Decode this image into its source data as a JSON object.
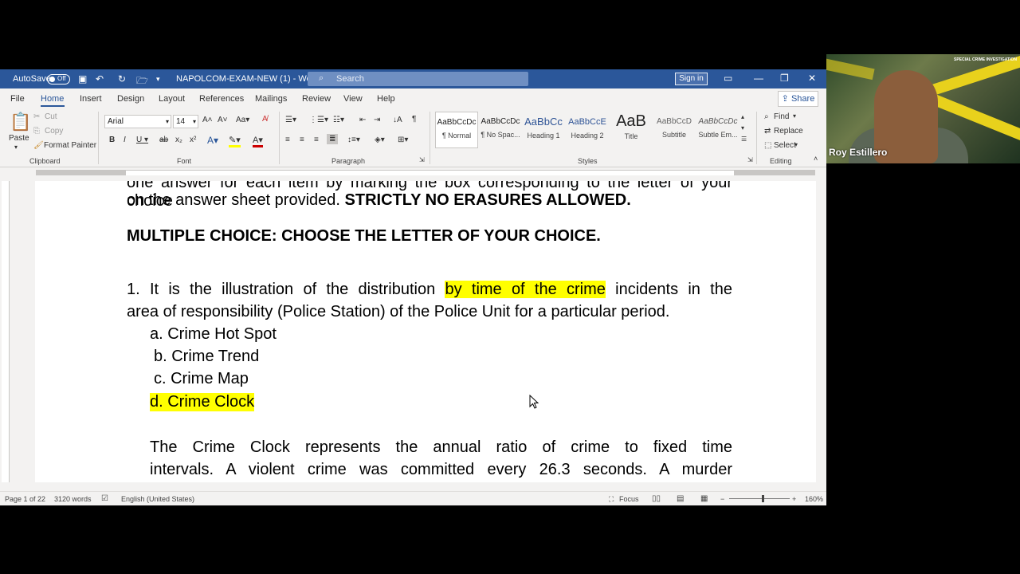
{
  "titlebar": {
    "autosave_label": "AutoSave",
    "autosave_state": "Off",
    "doc_title": "NAPOLCOM-EXAM-NEW (1)  -  Word",
    "search_placeholder": "Search",
    "signin_label": "Sign in"
  },
  "menu": {
    "tabs": [
      "File",
      "Home",
      "Insert",
      "Design",
      "Layout",
      "References",
      "Mailings",
      "Review",
      "View",
      "Help"
    ],
    "active": "Home",
    "share_label": "Share"
  },
  "ribbon": {
    "clipboard": {
      "paste": "Paste",
      "cut": "Cut",
      "copy": "Copy",
      "format_painter": "Format Painter",
      "group": "Clipboard"
    },
    "font": {
      "name": "Arial",
      "size": "14",
      "group": "Font"
    },
    "paragraph": {
      "group": "Paragraph"
    },
    "styles": {
      "group": "Styles",
      "items": [
        {
          "sample": "AaBbCcDc",
          "name": "¶ Normal"
        },
        {
          "sample": "AaBbCcDc",
          "name": "¶ No Spac..."
        },
        {
          "sample": "AaBbCc",
          "name": "Heading 1"
        },
        {
          "sample": "AaBbCcE",
          "name": "Heading 2"
        },
        {
          "sample": "AaB",
          "name": "Title"
        },
        {
          "sample": "AaBbCcD",
          "name": "Subtitle"
        },
        {
          "sample": "AaBbCcDc",
          "name": "Subtle Em..."
        }
      ]
    },
    "editing": {
      "find": "Find",
      "replace": "Replace",
      "select": "Select",
      "group": "Editing"
    }
  },
  "document": {
    "line1": "one answer for each item by marking the box corresponding to the letter of your choice",
    "line2_pre": "on the answer sheet provided. ",
    "line2_bold": "STRICTLY NO ERASURES ALLOWED.",
    "heading": "MULTIPLE CHOICE: CHOOSE THE LETTER OF YOUR CHOICE.",
    "q1_pre": "1. It is the illustration of the distribution ",
    "q1_highlight": "by time of the crime",
    "q1_post": " incidents in the",
    "q1_line2": "area of responsibility (Police Station) of the Police Unit for a particular period.",
    "options": [
      "a. Crime Hot Spot",
      "b. Crime Trend",
      "c. Crime Map",
      "d. Crime Clock"
    ],
    "explanation_line1": "The Crime Clock represents the annual ratio of crime to fixed time",
    "explanation_line2": "intervals. A violent crime was committed every 26.3 seconds. A murder"
  },
  "status": {
    "page": "Page 1 of 22",
    "words": "3120 words",
    "language": "English (United States)",
    "focus": "Focus",
    "zoom": "160%"
  },
  "webcam": {
    "name": "Roy Estillero",
    "banner": "SPECIAL CRIME INVESTIGATION"
  },
  "colors": {
    "word_blue": "#2b579a",
    "highlight": "#ffff00"
  }
}
